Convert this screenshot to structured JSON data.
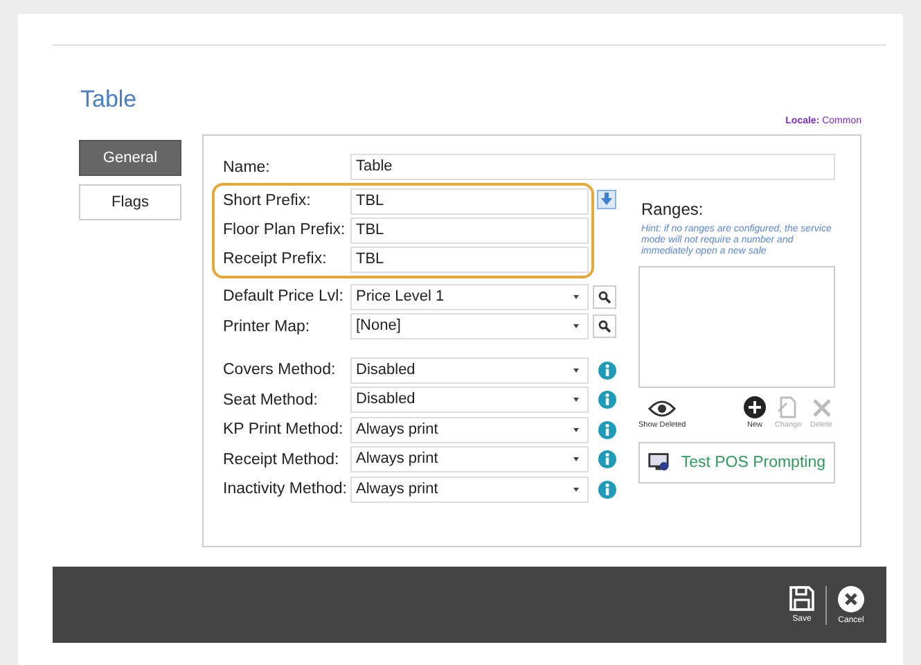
{
  "title": "Table",
  "locale": {
    "label": "Locale:",
    "value": "Common"
  },
  "tabs": [
    {
      "label": "General",
      "selected": true
    },
    {
      "label": "Flags",
      "selected": false
    }
  ],
  "name_field": {
    "label": "Name:",
    "value": "Table"
  },
  "prefix_fields": [
    {
      "label": "Short Prefix:",
      "value": "TBL"
    },
    {
      "label": "Floor Plan Prefix:",
      "value": "TBL"
    },
    {
      "label": "Receipt Prefix:",
      "value": "TBL"
    }
  ],
  "lookup_fields": [
    {
      "label": "Default Price Lvl:",
      "value": "Price Level 1"
    },
    {
      "label": "Printer Map:",
      "value": "[None]"
    }
  ],
  "method_fields": [
    {
      "label": "Covers Method:",
      "value": "Disabled"
    },
    {
      "label": "Seat Method:",
      "value": "Disabled"
    },
    {
      "label": "KP Print Method:",
      "value": "Always print"
    },
    {
      "label": "Receipt Method:",
      "value": "Always print"
    },
    {
      "label": "Inactivity Method:",
      "value": "Always print"
    }
  ],
  "ranges": {
    "title": "Ranges:",
    "hint": "Hint: if no ranges are configured, the service mode will not require a number and immediately open a new sale",
    "actions": [
      {
        "kind": "eye",
        "label": "Show Deleted",
        "disabled": false
      },
      {
        "kind": "plus",
        "label": "New",
        "disabled": false
      },
      {
        "kind": "edit",
        "label": "Change",
        "disabled": true
      },
      {
        "kind": "delete",
        "label": "Delete",
        "disabled": true
      }
    ],
    "test_button": "Test POS Prompting"
  },
  "footer_buttons": [
    {
      "kind": "save",
      "label": "Save"
    },
    {
      "kind": "cancel",
      "label": "Cancel"
    }
  ]
}
